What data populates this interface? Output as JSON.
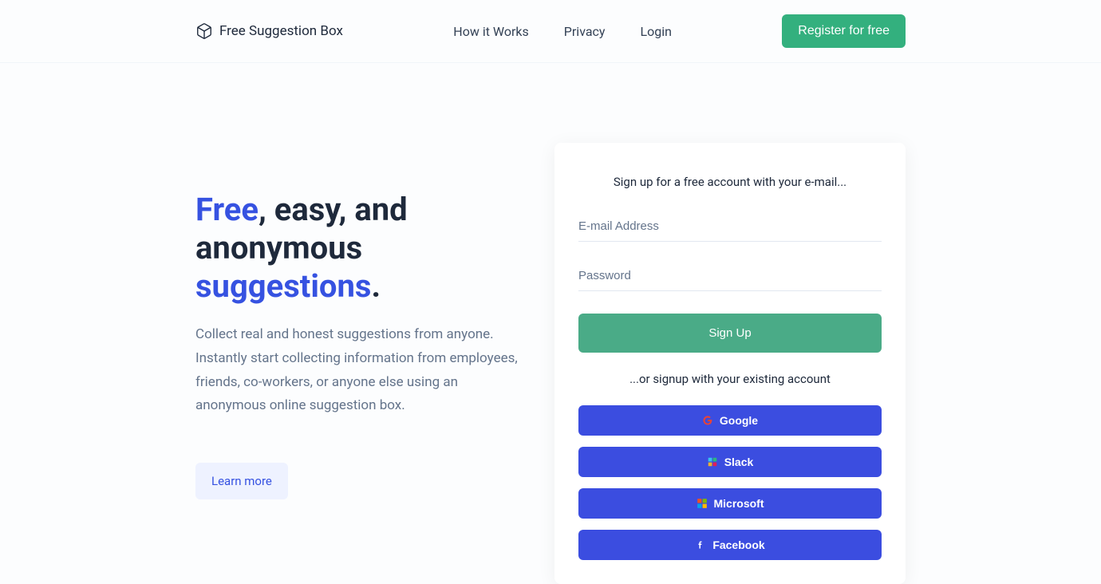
{
  "header": {
    "logo_text": "Free Suggestion Box",
    "nav": {
      "how": "How it Works",
      "privacy": "Privacy",
      "login": "Login"
    },
    "register_label": "Register for free"
  },
  "hero": {
    "title_free": "Free",
    "title_mid": ", easy, and anonymous ",
    "title_sugg": "suggestions",
    "title_end": ".",
    "description": "Collect real and honest suggestions from anyone. Instantly start collecting information from employees, friends, co-workers, or anyone else using an anonymous online suggestion box.",
    "learn_more_label": "Learn more"
  },
  "signup": {
    "title": "Sign up for a free account with your e-mail...",
    "email_placeholder": "E-mail Address",
    "password_placeholder": "Password",
    "submit_label": "Sign Up",
    "divider_text": "...or signup with your existing account",
    "oauth": {
      "google": "Google",
      "slack": "Slack",
      "microsoft": "Microsoft",
      "facebook": "Facebook"
    }
  }
}
